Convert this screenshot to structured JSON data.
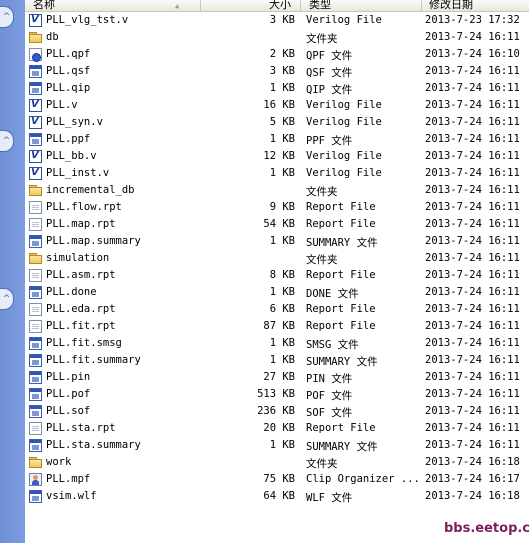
{
  "header": {
    "name": "名称",
    "size": "大小",
    "type": "类型",
    "modified": "修改日期"
  },
  "files": [
    {
      "name": "PLL_vlg_tst.v",
      "size": "3 KB",
      "type": "Verilog File",
      "date": "2013-7-23 17:32",
      "icon": "verilog-file-icon"
    },
    {
      "name": "db",
      "size": "",
      "type": "文件夹",
      "date": "2013-7-24 16:11",
      "icon": "folder-icon"
    },
    {
      "name": "PLL.qpf",
      "size": "2 KB",
      "type": "QPF 文件",
      "date": "2013-7-24 16:10",
      "icon": "quartus-project-icon"
    },
    {
      "name": "PLL.qsf",
      "size": "3 KB",
      "type": "QSF 文件",
      "date": "2013-7-24 16:11",
      "icon": "app-file-icon"
    },
    {
      "name": "PLL.qip",
      "size": "1 KB",
      "type": "QIP 文件",
      "date": "2013-7-24 16:11",
      "icon": "app-file-icon"
    },
    {
      "name": "PLL.v",
      "size": "16 KB",
      "type": "Verilog File",
      "date": "2013-7-24 16:11",
      "icon": "verilog-file-icon"
    },
    {
      "name": "PLL_syn.v",
      "size": "5 KB",
      "type": "Verilog File",
      "date": "2013-7-24 16:11",
      "icon": "verilog-file-icon"
    },
    {
      "name": "PLL.ppf",
      "size": "1 KB",
      "type": "PPF 文件",
      "date": "2013-7-24 16:11",
      "icon": "app-file-icon"
    },
    {
      "name": "PLL_bb.v",
      "size": "12 KB",
      "type": "Verilog File",
      "date": "2013-7-24 16:11",
      "icon": "verilog-file-icon"
    },
    {
      "name": "PLL_inst.v",
      "size": "1 KB",
      "type": "Verilog File",
      "date": "2013-7-24 16:11",
      "icon": "verilog-file-icon"
    },
    {
      "name": "incremental_db",
      "size": "",
      "type": "文件夹",
      "date": "2013-7-24 16:11",
      "icon": "folder-icon"
    },
    {
      "name": "PLL.flow.rpt",
      "size": "9 KB",
      "type": "Report File",
      "date": "2013-7-24 16:11",
      "icon": "document-icon"
    },
    {
      "name": "PLL.map.rpt",
      "size": "54 KB",
      "type": "Report File",
      "date": "2013-7-24 16:11",
      "icon": "document-icon"
    },
    {
      "name": "PLL.map.summary",
      "size": "1 KB",
      "type": "SUMMARY 文件",
      "date": "2013-7-24 16:11",
      "icon": "app-file-icon"
    },
    {
      "name": "simulation",
      "size": "",
      "type": "文件夹",
      "date": "2013-7-24 16:11",
      "icon": "folder-icon"
    },
    {
      "name": "PLL.asm.rpt",
      "size": "8 KB",
      "type": "Report File",
      "date": "2013-7-24 16:11",
      "icon": "document-icon"
    },
    {
      "name": "PLL.done",
      "size": "1 KB",
      "type": "DONE 文件",
      "date": "2013-7-24 16:11",
      "icon": "app-file-icon"
    },
    {
      "name": "PLL.eda.rpt",
      "size": "6 KB",
      "type": "Report File",
      "date": "2013-7-24 16:11",
      "icon": "document-icon"
    },
    {
      "name": "PLL.fit.rpt",
      "size": "87 KB",
      "type": "Report File",
      "date": "2013-7-24 16:11",
      "icon": "document-icon"
    },
    {
      "name": "PLL.fit.smsg",
      "size": "1 KB",
      "type": "SMSG 文件",
      "date": "2013-7-24 16:11",
      "icon": "app-file-icon"
    },
    {
      "name": "PLL.fit.summary",
      "size": "1 KB",
      "type": "SUMMARY 文件",
      "date": "2013-7-24 16:11",
      "icon": "app-file-icon"
    },
    {
      "name": "PLL.pin",
      "size": "27 KB",
      "type": "PIN 文件",
      "date": "2013-7-24 16:11",
      "icon": "app-file-icon"
    },
    {
      "name": "PLL.pof",
      "size": "513 KB",
      "type": "POF 文件",
      "date": "2013-7-24 16:11",
      "icon": "app-file-icon"
    },
    {
      "name": "PLL.sof",
      "size": "236 KB",
      "type": "SOF 文件",
      "date": "2013-7-24 16:11",
      "icon": "app-file-icon"
    },
    {
      "name": "PLL.sta.rpt",
      "size": "20 KB",
      "type": "Report File",
      "date": "2013-7-24 16:11",
      "icon": "document-icon"
    },
    {
      "name": "PLL.sta.summary",
      "size": "1 KB",
      "type": "SUMMARY 文件",
      "date": "2013-7-24 16:11",
      "icon": "app-file-icon"
    },
    {
      "name": "work",
      "size": "",
      "type": "文件夹",
      "date": "2013-7-24 16:18",
      "icon": "folder-icon"
    },
    {
      "name": "PLL.mpf",
      "size": "75 KB",
      "type": "Clip Organizer ...",
      "date": "2013-7-24 16:17",
      "icon": "clip-organizer-icon"
    },
    {
      "name": "vsim.wlf",
      "size": "64 KB",
      "type": "WLF 文件",
      "date": "2013-7-24 16:18",
      "icon": "app-file-icon"
    }
  ],
  "watermark": "bbs.eetop.cn",
  "left_pane_buttons": [
    "^",
    "^",
    "^"
  ]
}
